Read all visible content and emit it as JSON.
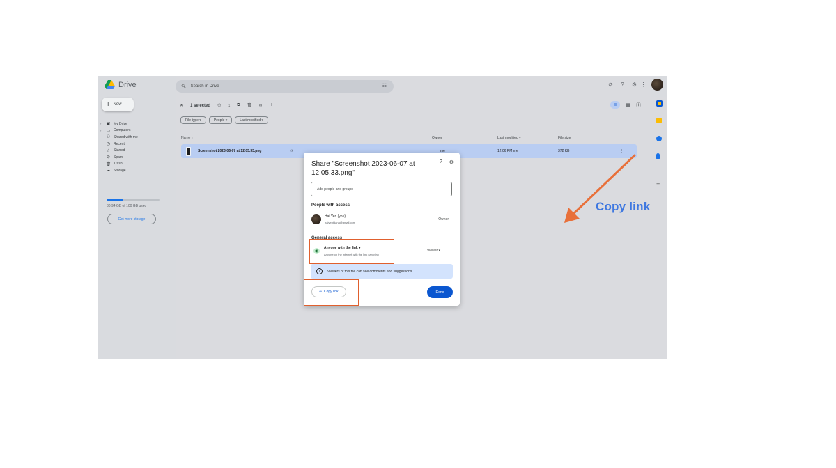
{
  "app": {
    "name": "Drive"
  },
  "sidebar": {
    "new_label": "New",
    "items": [
      {
        "label": "My Drive",
        "icon": "my-drive-icon",
        "glyph": "▣",
        "caret": "›"
      },
      {
        "label": "Computers",
        "icon": "computer-icon",
        "glyph": "▭",
        "caret": "›"
      },
      {
        "label": "Shared with me",
        "icon": "people-icon",
        "glyph": "⚇",
        "caret": ""
      },
      {
        "label": "Recent",
        "icon": "clock-icon",
        "glyph": "◷",
        "caret": ""
      },
      {
        "label": "Starred",
        "icon": "star-icon",
        "glyph": "☆",
        "caret": ""
      },
      {
        "label": "Spam",
        "icon": "spam-icon",
        "glyph": "⊘",
        "caret": ""
      },
      {
        "label": "Trash",
        "icon": "trash-icon",
        "glyph": "🗑",
        "caret": ""
      },
      {
        "label": "Storage",
        "icon": "cloud-icon",
        "glyph": "☁",
        "caret": ""
      }
    ],
    "storage_text": "30.94 GB of 100 GB used",
    "storage_fraction": 0.3094,
    "get_storage_label": "Get more storage"
  },
  "search": {
    "placeholder": "Search in Drive"
  },
  "toolbar": {
    "selected_label": "1 selected"
  },
  "chips": [
    "File type",
    "People",
    "Last modified"
  ],
  "columns": {
    "name": "Name",
    "owner": "Owner",
    "modified": "Last modified",
    "size": "File size"
  },
  "file": {
    "name": "Screenshot 2023-06-07 at 12.05.33.png",
    "owner": "me",
    "modified": "12:06 PM me",
    "size": "372 KB"
  },
  "dialog": {
    "title": "Share \"Screenshot 2023-06-07 at 12.05.33.png\"",
    "add_placeholder": "Add people and groups",
    "people_heading": "People with access",
    "person_name": "Hai Yen (you)",
    "person_email": "haiyentdana@gmail.com",
    "person_role": "Owner",
    "general_heading": "General access",
    "access_label": "Anyone with the link",
    "access_desc": "Anyone on the internet with the link can view",
    "access_role": "Viewer",
    "info_text": "Viewers of this file can see comments and suggestions",
    "copy_label": "Copy link",
    "done_label": "Done"
  },
  "annotation": {
    "text": "Copy link",
    "color": "#3f78e0",
    "arrow_color": "#e8703a"
  }
}
